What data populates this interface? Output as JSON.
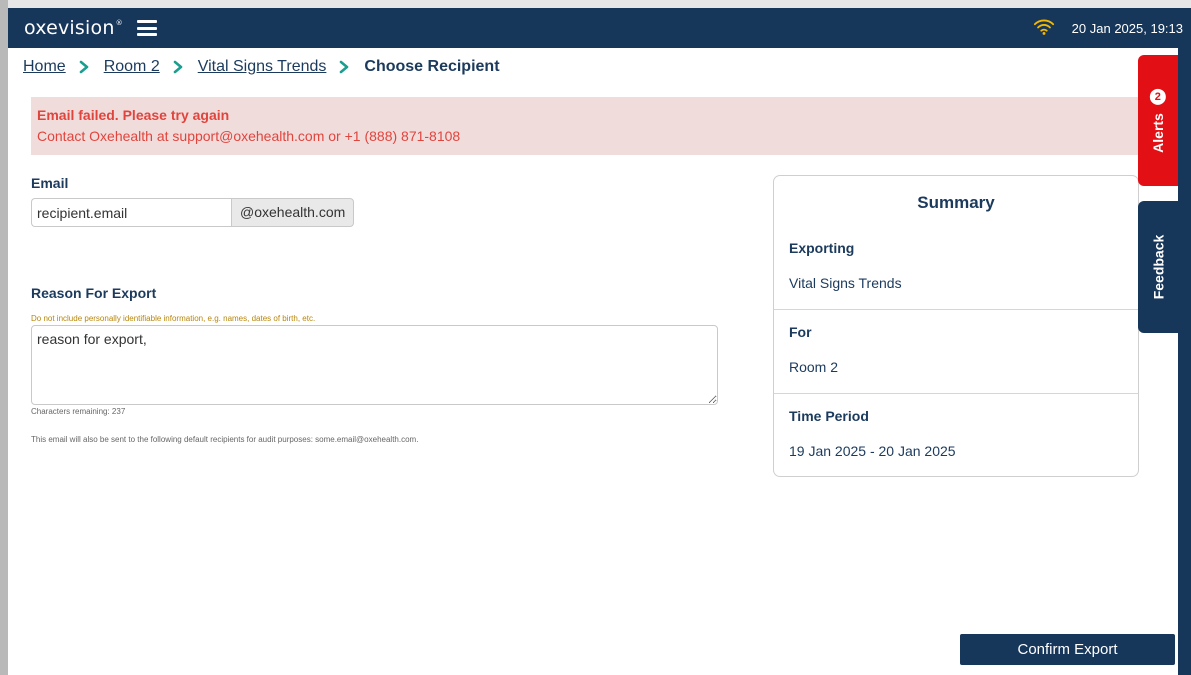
{
  "header": {
    "logo": "oxevision",
    "logo_mark": "®",
    "datetime": "20 Jan 2025, 19:13",
    "wifi_icon": "wifi-icon",
    "menu_icon": "hamburger-menu-icon"
  },
  "breadcrumb": {
    "items": [
      "Home",
      "Room 2",
      "Vital Signs Trends"
    ],
    "current": "Choose Recipient"
  },
  "error": {
    "title": "Email failed. Please try again",
    "message": "Contact Oxehealth at support@oxehealth.com or +1 (888) 871-8108"
  },
  "form": {
    "email_label": "Email",
    "email_value": "recipient.email",
    "email_suffix": "@oxehealth.com",
    "reason_label": "Reason For Export",
    "reason_hint": "Do not include personally identifiable information, e.g. names, dates of birth, etc.",
    "reason_value": "reason for export,",
    "chars_remaining": "Characters remaining: 237",
    "audit_note": "This email will also be sent to the following default recipients for audit purposes: some.email@oxehealth.com."
  },
  "summary": {
    "title": "Summary",
    "exporting_label": "Exporting",
    "exporting_value": "Vital Signs Trends",
    "for_label": "For",
    "for_value": "Room 2",
    "period_label": "Time Period",
    "period_value": "19 Jan 2025 - 20 Jan 2025"
  },
  "side_tabs": {
    "alerts_label": "Alerts",
    "alerts_count": "2",
    "feedback_label": "Feedback"
  },
  "actions": {
    "confirm_label": "Confirm Export"
  },
  "colors": {
    "navy": "#16365a",
    "alert_red": "#e20f14",
    "error_bg": "#f1dcdc",
    "error_text": "#e0453d",
    "chevron": "#1a9e8f"
  }
}
